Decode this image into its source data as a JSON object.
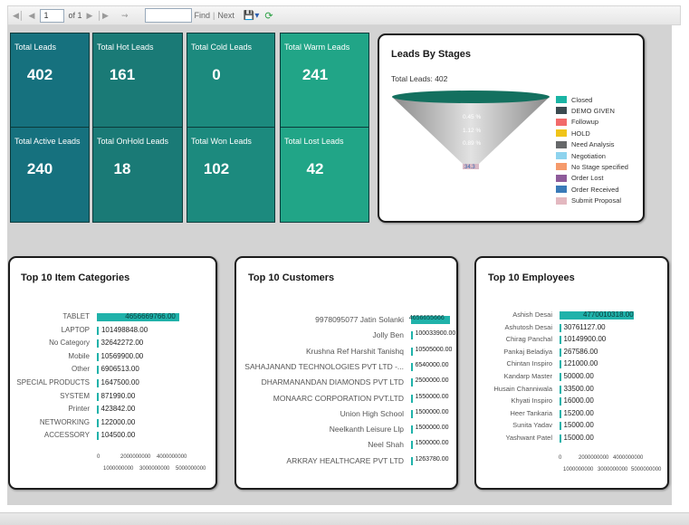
{
  "toolbar": {
    "first_icon": "first-page-icon",
    "prev_icon": "previous-page-icon",
    "page_value": "1",
    "page_of": "of 1",
    "next_icon": "next-page-icon",
    "last_icon": "last-page-icon",
    "back_icon": "back-to-parent-icon",
    "find_value": "",
    "find_label": "Find",
    "separator": "|",
    "next_label": "Next",
    "export_icon": "export-save-icon",
    "refresh_icon": "refresh-icon"
  },
  "colors": {
    "tile_colors": [
      "#16717e",
      "#1a7a76",
      "#1c8a7e",
      "#21a587"
    ],
    "bar_color": "#20b2aa",
    "canvas_bg": "#d3d3d3"
  },
  "kpis": [
    {
      "label": "Total Leads",
      "value": "402"
    },
    {
      "label": "Total Hot Leads",
      "value": "161"
    },
    {
      "label": "Total Cold Leads",
      "value": "0"
    },
    {
      "label": "Total Warm Leads",
      "value": "241"
    },
    {
      "label": "Total Active Leads",
      "value": "240"
    },
    {
      "label": "Total OnHold Leads",
      "value": "18"
    },
    {
      "label": "Total Won Leads",
      "value": "102"
    },
    {
      "label": "Total Lost Leads",
      "value": "42"
    }
  ],
  "funnel": {
    "title": "Leads By Stages",
    "subtitle": "Total Leads: 402",
    "slice_labels": [
      "0.45 %",
      "1.12 %",
      "0.89 %",
      "34.3"
    ],
    "legend": [
      {
        "name": "Closed",
        "color": "#1ab4a4"
      },
      {
        "name": "DEMO GIVEN",
        "color": "#3c4a50"
      },
      {
        "name": "Followup",
        "color": "#f26a6a"
      },
      {
        "name": "HOLD",
        "color": "#f0c419"
      },
      {
        "name": "Need Analysis",
        "color": "#66686a"
      },
      {
        "name": "Negotiation",
        "color": "#8dd3ee"
      },
      {
        "name": "No Stage specified",
        "color": "#f59a6b"
      },
      {
        "name": "Order Lost",
        "color": "#8e5b9a"
      },
      {
        "name": "Order Received",
        "color": "#3a7ab8"
      },
      {
        "name": "Submit Proposal",
        "color": "#e3b8c0"
      }
    ]
  },
  "categories": {
    "title": "Top 10 Item Categories",
    "axis_top": [
      "0",
      "2000000000",
      "4000000000"
    ],
    "axis_bottom": [
      "1000000000",
      "3000000000",
      "5000000000"
    ],
    "axis_max": 5000000000,
    "rows": [
      {
        "label": "TABLET",
        "value": 4656669766.0,
        "value_label": "4656669766.00"
      },
      {
        "label": "LAPTOP",
        "value": 101498848.0,
        "value_label": "101498848.00"
      },
      {
        "label": "No Category",
        "value": 32642272.0,
        "value_label": "32642272.00"
      },
      {
        "label": "Mobile",
        "value": 10569900.0,
        "value_label": "10569900.00"
      },
      {
        "label": "Other",
        "value": 6906513.0,
        "value_label": "6906513.00"
      },
      {
        "label": "SPECIAL PRODUCTS",
        "value": 1647500.0,
        "value_label": "1647500.00"
      },
      {
        "label": "SYSTEM",
        "value": 871990.0,
        "value_label": "871990.00"
      },
      {
        "label": "Printer",
        "value": 423842.0,
        "value_label": "423842.00"
      },
      {
        "label": "NETWORKING",
        "value": 122000.0,
        "value_label": "122000.00"
      },
      {
        "label": "ACCESSORY",
        "value": 104500.0,
        "value_label": "104500.00"
      }
    ]
  },
  "customers": {
    "title": "Top 10 Customers",
    "axis_max": 5000000000,
    "rows": [
      {
        "label": "9978095077 Jatin Solanki",
        "value": 4656655666,
        "value_label": "4656655666"
      },
      {
        "label": "Jolly Ben",
        "value": 100033900,
        "value_label": "100033900.00"
      },
      {
        "label": "Krushna Ref Harshit Tanishq",
        "value": 10505000,
        "value_label": "10505000.00"
      },
      {
        "label": "SAHAJANAND TECHNOLOGIES PVT LTD -...",
        "value": 6540000,
        "value_label": "6540000.00"
      },
      {
        "label": "DHARMANANDAN DIAMONDS PVT  LTD",
        "value": 2500000,
        "value_label": "2500000.00"
      },
      {
        "label": "MONAARC CORPORATION PVT.LTD",
        "value": 1550000,
        "value_label": "1550000.00"
      },
      {
        "label": "Union High School",
        "value": 1500000,
        "value_label": "1500000.00"
      },
      {
        "label": "Neelkanth Leisure Llp",
        "value": 1500000,
        "value_label": "1500000.00"
      },
      {
        "label": "Neel Shah",
        "value": 1500000,
        "value_label": "1500000.00"
      },
      {
        "label": "ARKRAY HEALTHCARE PVT LTD",
        "value": 1263780,
        "value_label": "1263780.00"
      }
    ]
  },
  "employees": {
    "title": "Top 10 Employees",
    "axis_top": [
      "0",
      "2000000000",
      "4000000000"
    ],
    "axis_bottom": [
      "1000000000",
      "3000000000",
      "5000000000"
    ],
    "axis_max": 5000000000,
    "rows": [
      {
        "label": "Ashish Desai",
        "value": 4770010318.0,
        "value_label": "4770010318.00"
      },
      {
        "label": "Ashutosh Desai",
        "value": 30761127.0,
        "value_label": "30761127.00"
      },
      {
        "label": "Chirag Panchal",
        "value": 10149900.0,
        "value_label": "10149900.00"
      },
      {
        "label": "Pankaj Beladiya",
        "value": 267586.0,
        "value_label": "267586.00"
      },
      {
        "label": "Chintan Inspiro",
        "value": 121000.0,
        "value_label": "121000.00"
      },
      {
        "label": "Kandarp Master",
        "value": 50000.0,
        "value_label": "50000.00"
      },
      {
        "label": "Husain Channiwala",
        "value": 33500.0,
        "value_label": "33500.00"
      },
      {
        "label": "Khyati Inspiro",
        "value": 16000.0,
        "value_label": "16000.00"
      },
      {
        "label": "Heer Tankaria",
        "value": 15200.0,
        "value_label": "15200.00"
      },
      {
        "label": "Sunita Yadav",
        "value": 15000.0,
        "value_label": "15000.00"
      },
      {
        "label": "Yashwant Patel",
        "value": 15000.0,
        "value_label": "15000.00"
      }
    ]
  }
}
